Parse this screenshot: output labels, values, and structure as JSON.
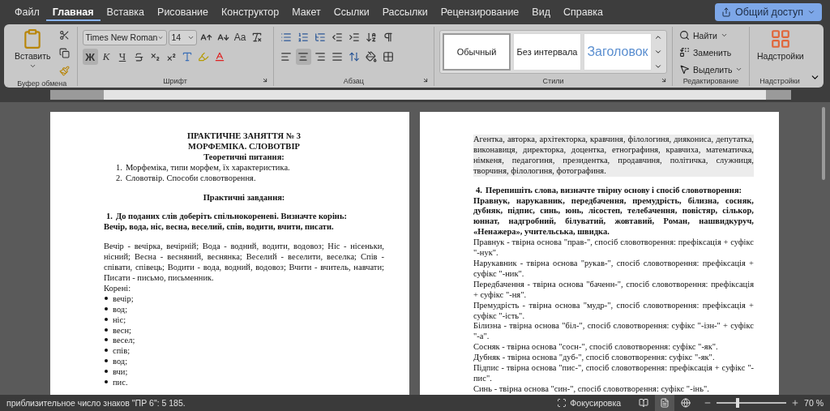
{
  "tabs": [
    {
      "label": "Файл",
      "selected": false
    },
    {
      "label": "Главная",
      "selected": true
    },
    {
      "label": "Вставка",
      "selected": false
    },
    {
      "label": "Рисование",
      "selected": false
    },
    {
      "label": "Конструктор",
      "selected": false
    },
    {
      "label": "Макет",
      "selected": false
    },
    {
      "label": "Ссылки",
      "selected": false
    },
    {
      "label": "Рассылки",
      "selected": false
    },
    {
      "label": "Рецензирование",
      "selected": false
    },
    {
      "label": "Вид",
      "selected": false
    },
    {
      "label": "Справка",
      "selected": false
    }
  ],
  "share_button": "Общий доступ",
  "ribbon": {
    "clipboard": {
      "paste": "Вставить",
      "group_label": "Буфер обмена"
    },
    "font": {
      "font_name": "Times New Roman",
      "font_size": "14",
      "bold": "Ж",
      "italic": "К",
      "underline": "Ч",
      "change_case": "Aa",
      "group_label": "Шрифт"
    },
    "paragraph": {
      "group_label": "Абзац"
    },
    "styles": {
      "items": [
        {
          "kind": "normal",
          "label": "Обычный",
          "selected": true
        },
        {
          "kind": "no_spacing",
          "label": "Без интервала",
          "selected": false
        },
        {
          "kind": "heading",
          "label": "Заголовок",
          "selected": false
        }
      ],
      "group_label": "Стили"
    },
    "editing": {
      "items": [
        {
          "kind": "find",
          "label": "Найти"
        },
        {
          "kind": "replace",
          "label": "Заменить"
        },
        {
          "kind": "select",
          "label": "Выделить"
        }
      ],
      "group_label": "Редактирование"
    },
    "addins": {
      "button": "Надстройки",
      "group_label": "Надстройки"
    }
  },
  "pages": [
    {
      "paragraphs": [
        {
          "kind": "title",
          "text": "ПРАКТИЧНЕ ЗАНЯТТЯ № 3"
        },
        {
          "kind": "title",
          "text": "МОРФЕМІКА. СЛОВОТВІР"
        },
        {
          "kind": "title",
          "text": "Теоретичні питання:"
        },
        {
          "kind": "numbered",
          "number": "1.",
          "text": "Морфеміка, типи морфем, їх характеристика."
        },
        {
          "kind": "numbered",
          "number": "2.",
          "text": "Словотвір. Способи словотворення."
        },
        {
          "kind": "spacer"
        },
        {
          "kind": "title",
          "text": "Практичні завдання:"
        },
        {
          "kind": "spacer"
        },
        {
          "kind": "task",
          "number": "1.",
          "text": "До поданих слів доберіть спільнокореневі. Визначте корінь:"
        },
        {
          "kind": "bold",
          "text": "Вечір, вода, ніс, весна, веселий, спів, водити, вчити, писати."
        },
        {
          "kind": "spacer"
        },
        {
          "kind": "body",
          "highlighted": false,
          "text": "Вечір - вечірка, вечірній; Вода - водний, водити, водовоз; Ніс - нісеньки, нісний; Весна - весняний, веснянка; Веселий - веселити, веселка; Спів - співати, співець; Водити - вода, водний, водовоз; Вчити - вчитель, навчати; Писати - письмо, письменник."
        },
        {
          "kind": "body",
          "highlighted": false,
          "text": "Корені:"
        },
        {
          "kind": "bullet",
          "text": "вечір;"
        },
        {
          "kind": "bullet",
          "text": "вод;"
        },
        {
          "kind": "bullet",
          "text": "ніс;"
        },
        {
          "kind": "bullet",
          "text": "весн;"
        },
        {
          "kind": "bullet",
          "text": "весел;"
        },
        {
          "kind": "bullet",
          "text": "спів;"
        },
        {
          "kind": "bullet",
          "text": "вод;"
        },
        {
          "kind": "bullet",
          "text": "вчи;"
        },
        {
          "kind": "bullet",
          "text": "пис."
        }
      ]
    },
    {
      "paragraphs": [
        {
          "kind": "body",
          "highlighted": true,
          "text": "Агентка, авторка, архітекторка, кравчиня, філологиня, диякониса, депутатка, виконавиця, директорка, доцентка, етнографиня, кравчиха, математичка, німкеня, педагогиня, президентка, продавчиня, політичка, служниця, творчиня, філологиня, фотографиня."
        },
        {
          "kind": "spacer"
        },
        {
          "kind": "task",
          "number": "4.",
          "text": "Перепишіть слова, визначте твірну основу і спосіб словотворення:"
        },
        {
          "kind": "bold",
          "text": "Правнук, нарукавник, передбачення, премудрість, білизна, сосняк, дубняк, підпис, синь, юнь, лісостеп, телебачення, повістяр, сількор, юннат, надгробний, білуватий, жовтавий, Роман, нашвидкуруч, «Ненажера», учительська, швидка."
        },
        {
          "kind": "body",
          "highlighted": false,
          "text": "Правнук - твірна основа \"прав-\", спосіб словотворення: префіксація + суфікс \"-нук\"."
        },
        {
          "kind": "body",
          "highlighted": false,
          "text": "Нарукавник - твірна основа \"рукав-\", спосіб словотворення: префіксація + суфікс \"-ник\"."
        },
        {
          "kind": "body",
          "highlighted": false,
          "text": "Передбачення - твірна основа \"баченн-\", спосіб словотворення: префіксація + суфікс \"-ня\"."
        },
        {
          "kind": "body",
          "highlighted": false,
          "text": "Премудрість - твірна основа \"мудр-\", спосіб словотворення: префіксація + суфікс \"-ість\"."
        },
        {
          "kind": "body",
          "highlighted": false,
          "text": "Білизна - твірна основа \"біл-\", спосіб словотворення: суфікс \"-ізн-\" + суфікс \"-а\"."
        },
        {
          "kind": "body",
          "highlighted": false,
          "text": "Сосняк - твірна основа \"сосн-\", спосіб словотворення: суфікс \"-як\"."
        },
        {
          "kind": "body",
          "highlighted": false,
          "text": "Дубняк - твірна основа \"дуб-\", спосіб словотворення: суфікс \"-як\"."
        },
        {
          "kind": "body",
          "highlighted": false,
          "text": "Підпис - твірна основа \"пис-\", спосіб словотворення: префіксація + суфікс \"-пис\"."
        },
        {
          "kind": "body",
          "highlighted": false,
          "text": "Синь - твірна основа \"син-\", спосіб словотворення: суфікс \"-інь\"."
        }
      ]
    }
  ],
  "status_bar": {
    "text": "приблизительное число знаков \"ПР 6\": 5 185.",
    "focus": "Фокусировка",
    "views": [
      {
        "kind": "read",
        "selected": false
      },
      {
        "kind": "print",
        "selected": true
      },
      {
        "kind": "web",
        "selected": false
      }
    ],
    "zoom": {
      "level": 0.3,
      "reading": "70 %"
    }
  }
}
